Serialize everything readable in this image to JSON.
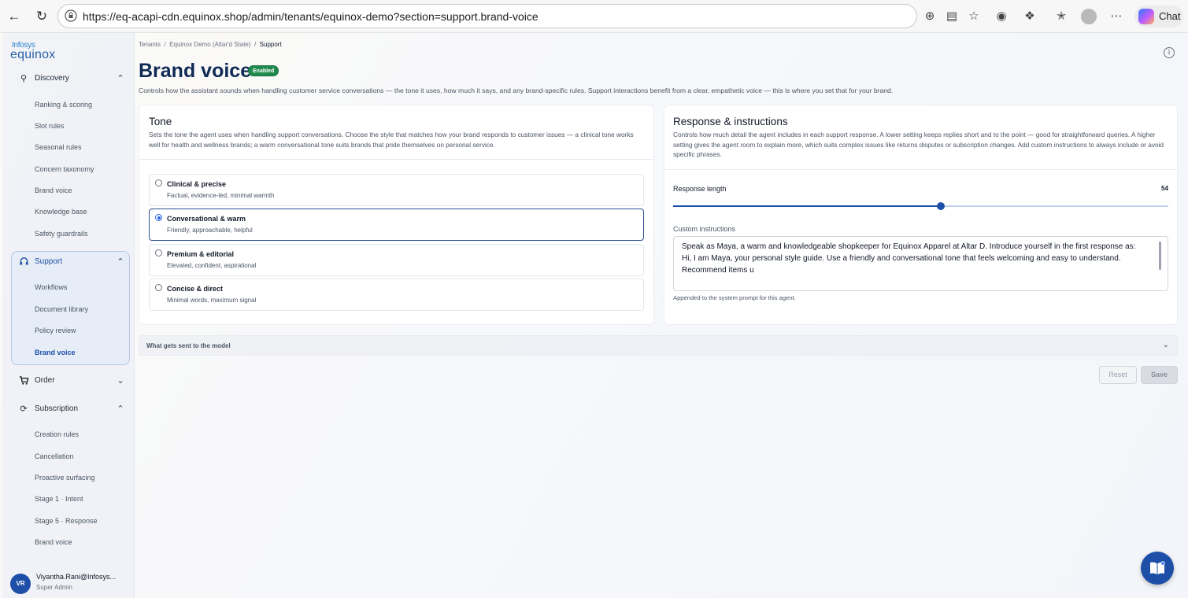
{
  "browser": {
    "url_prefix": "https://",
    "url_host": "eq-acapi-cdn.equinox.shop",
    "url_path": "/admin/tenants/equinox-demo?section=support.brand-voice",
    "chat_label": "Chat"
  },
  "brand": {
    "top": "Infosys",
    "main": "equinox"
  },
  "sidebar": {
    "discovery": {
      "label": "Discovery",
      "items": [
        "Ranking & scoring",
        "Slot rules",
        "Seasonal rules",
        "Concern taxonomy",
        "Brand voice",
        "Knowledge base",
        "Safety guardrails"
      ]
    },
    "support": {
      "label": "Support",
      "items": [
        "Workflows",
        "Document library",
        "Policy review",
        "Brand voice"
      ],
      "active_index": 3
    },
    "order": {
      "label": "Order"
    },
    "subscription": {
      "label": "Subscription",
      "items": [
        "Creation rules",
        "Cancellation",
        "Proactive surfacing",
        "Stage 1 · Intent",
        "Stage 5 · Response",
        "Brand voice"
      ]
    },
    "user": {
      "initials": "VR",
      "name": "Viyantha.Rani@Infosys...",
      "role": "Super Admin"
    }
  },
  "breadcrumb": {
    "items": [
      "Tenants",
      "Equinox Demo (Altar'd State)",
      "Support"
    ],
    "sep": "/"
  },
  "page": {
    "title": "Brand voice",
    "badge": "Enabled",
    "description": "Controls how the assistant sounds when handling customer service conversations — the tone it uses, how much it says, and any brand-specific rules. Support interactions benefit from a clear, empathetic voice — this is where you set that for your brand."
  },
  "tone": {
    "title": "Tone",
    "description": "Sets the tone the agent uses when handling support conversations. Choose the style that matches how your brand responds to customer issues — a clinical tone works well for health and wellness brands; a warm conversational tone suits brands that pride themselves on personal service.",
    "options": [
      {
        "title": "Clinical & precise",
        "desc": "Factual, evidence-led, minimal warmth"
      },
      {
        "title": "Conversational & warm",
        "desc": "Friendly, approachable, helpful"
      },
      {
        "title": "Premium & editorial",
        "desc": "Elevated, confident, aspirational"
      },
      {
        "title": "Concise & direct",
        "desc": "Minimal words, maximum signal"
      }
    ],
    "selected_index": 1
  },
  "response": {
    "title": "Response & instructions",
    "description": "Controls how much detail the agent includes in each support response. A lower setting keeps replies short and to the point — good for straightforward queries. A higher setting gives the agent room to explain more, which suits complex issues like returns disputes or subscription changes. Add custom instructions to always include or avoid specific phrases.",
    "length_label": "Response length",
    "length_value": 54,
    "length_min": 0,
    "length_max": 100,
    "custom_label": "Custom instructions",
    "custom_text": "Speak as Maya, a warm and knowledgeable shopkeeper for Equinox Apparel at Altar D. Introduce yourself in the first response as: Hi, I am Maya, your personal style guide. Use a friendly and conversational tone that feels welcoming and easy to understand. Recommend items u",
    "custom_help": "Appended to the system prompt for this agent."
  },
  "collapse": {
    "label": "What gets sent to the model"
  },
  "actions": {
    "reset": "Reset",
    "save": "Save"
  },
  "colors": {
    "accent": "#1e4fa8",
    "badge": "#1f8a4c",
    "title": "#0f2a55"
  }
}
